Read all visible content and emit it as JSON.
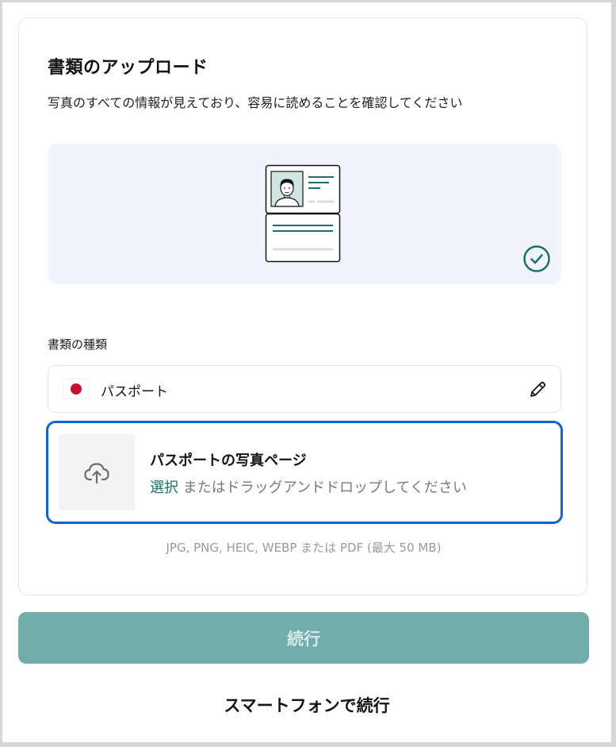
{
  "page": {
    "title": "書類のアップロード",
    "subtitle": "写真のすべての情報が見えており、容易に読めることを確認してください"
  },
  "illustration": {
    "document_icon": "id-document-illustration",
    "status_icon": "check-circle-icon",
    "background_color": "#f1f4fd",
    "accent_color": "#1c6f6a"
  },
  "document_type": {
    "label": "書類の種類",
    "value": "パスポート",
    "flag_icon": "japan-flag-icon",
    "edit_icon": "pencil-icon"
  },
  "upload": {
    "title": "パスポートの写真ページ",
    "select_link": "選択",
    "instruction": "またはドラッグアンドドロップしてください",
    "icon": "cloud-upload-icon",
    "border_color": "#1463c7",
    "formats_note": "JPG, PNG, HEIC, WEBP または PDF (最大 50 MB)"
  },
  "actions": {
    "continue_label": "続行",
    "continue_color": "#70adab",
    "phone_label": "スマートフォンで続行"
  }
}
